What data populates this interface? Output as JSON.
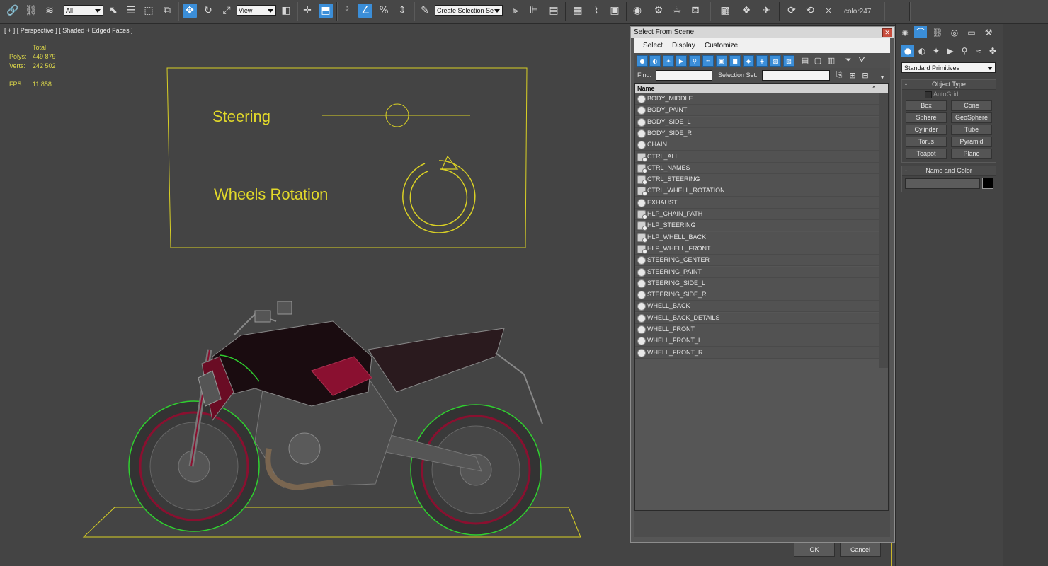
{
  "toolbar": {
    "filter_value": "All",
    "ref_coord_value": "View",
    "named_selection_value": "Create Selection Se",
    "color_label": "color247"
  },
  "viewport": {
    "label": "[ + ] [ Perspective ] [ Shaded + Edged Faces ]",
    "stats_header": "Total",
    "polys_label": "Polys:",
    "polys_value": "449 879",
    "verts_label": "Verts:",
    "verts_value": "242 502",
    "fps_label": "FPS:",
    "fps_value": "11,858",
    "control_panel": {
      "steering_label": "Steering",
      "wheels_label": "Wheels Rotation"
    },
    "colors": {
      "background": "#444444",
      "helper_yellow": "#d9d025",
      "selection_green": "#2fd02f",
      "paint_red": "#8a1030"
    }
  },
  "dialog": {
    "title": "Select From Scene",
    "close_glyph": "✕",
    "menu": [
      "Select",
      "Display",
      "Customize"
    ],
    "find_label": "Find:",
    "selection_set_label": "Selection Set:",
    "column_name": "Name",
    "items": [
      {
        "name": "BODY_MIDDLE",
        "kind": "geometry"
      },
      {
        "name": "BODY_PAINT",
        "kind": "geometry"
      },
      {
        "name": "BODY_SIDE_L",
        "kind": "geometry"
      },
      {
        "name": "BODY_SIDE_R",
        "kind": "geometry"
      },
      {
        "name": "CHAIN",
        "kind": "geometry"
      },
      {
        "name": "CTRL_ALL",
        "kind": "helper"
      },
      {
        "name": "CTRL_NAMES",
        "kind": "helper"
      },
      {
        "name": "CTRL_STEERING",
        "kind": "helper"
      },
      {
        "name": "CTRL_WHELL_ROTATION",
        "kind": "helper"
      },
      {
        "name": "EXHAUST",
        "kind": "geometry"
      },
      {
        "name": "HLP_CHAIN_PATH",
        "kind": "helper"
      },
      {
        "name": "HLP_STEERING",
        "kind": "helper"
      },
      {
        "name": "HLP_WHELL_BACK",
        "kind": "helper"
      },
      {
        "name": "HLP_WHELL_FRONT",
        "kind": "helper"
      },
      {
        "name": "STEERING_CENTER",
        "kind": "geometry"
      },
      {
        "name": "STEERING_PAINT",
        "kind": "geometry"
      },
      {
        "name": "STEERING_SIDE_L",
        "kind": "geometry"
      },
      {
        "name": "STEERING_SIDE_R",
        "kind": "geometry"
      },
      {
        "name": "WHELL_BACK",
        "kind": "geometry"
      },
      {
        "name": "WHELL_BACK_DETAILS",
        "kind": "geometry"
      },
      {
        "name": "WHELL_FRONT",
        "kind": "geometry"
      },
      {
        "name": "WHELL_FRONT_L",
        "kind": "geometry"
      },
      {
        "name": "WHELL_FRONT_R",
        "kind": "geometry"
      }
    ],
    "ok_label": "OK",
    "cancel_label": "Cancel"
  },
  "command_panel": {
    "category_value": "Standard Primitives",
    "object_type_title": "Object Type",
    "rollout_toggle": "-",
    "autogrid_label": "AutoGrid",
    "primitives": [
      "Box",
      "Cone",
      "Sphere",
      "GeoSphere",
      "Cylinder",
      "Tube",
      "Torus",
      "Pyramid",
      "Teapot",
      "Plane"
    ],
    "name_color_title": "Name and Color",
    "swatch_color": "#000000"
  }
}
